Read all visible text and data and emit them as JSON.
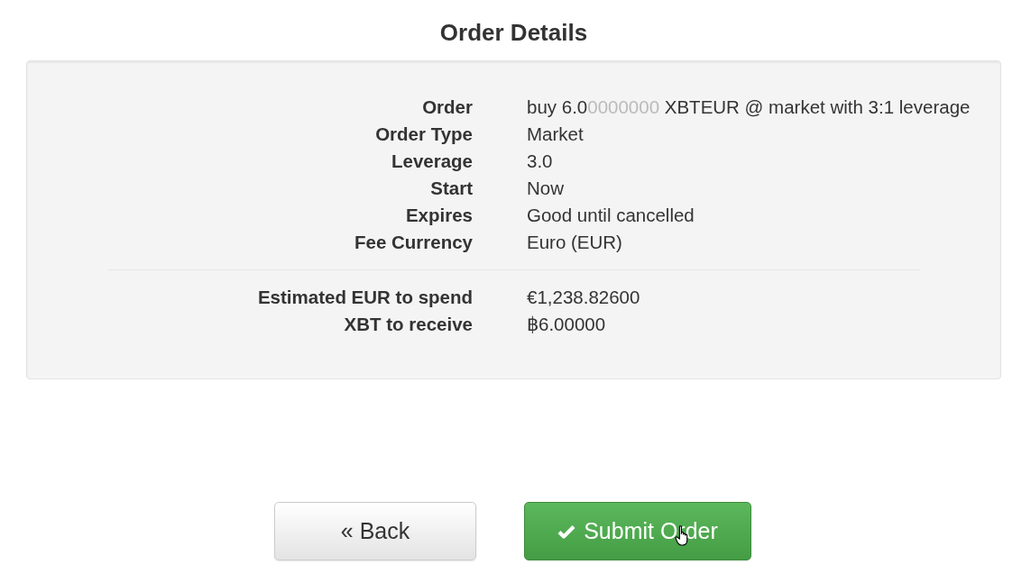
{
  "title": "Order Details",
  "details": [
    {
      "label": "Order",
      "parts": [
        {
          "text": "buy 6.0",
          "muted": false
        },
        {
          "text": "0000000",
          "muted": true
        },
        {
          "text": " XBTEUR @ market with 3:1 leverage",
          "muted": false
        }
      ]
    },
    {
      "label": "Order Type",
      "value": "Market"
    },
    {
      "label": "Leverage",
      "value": "3.0"
    },
    {
      "label": "Start",
      "value": "Now"
    },
    {
      "label": "Expires",
      "value": "Good until cancelled"
    },
    {
      "label": "Fee Currency",
      "value": "Euro (EUR)"
    }
  ],
  "totals": [
    {
      "label": "Estimated EUR to spend",
      "value": "€1,238.82600"
    },
    {
      "label": "XBT to receive",
      "value": "฿6.00000"
    }
  ],
  "buttons": [
    {
      "kind": "back",
      "label": "« Back"
    },
    {
      "kind": "submit",
      "label": "Submit Order"
    }
  ]
}
